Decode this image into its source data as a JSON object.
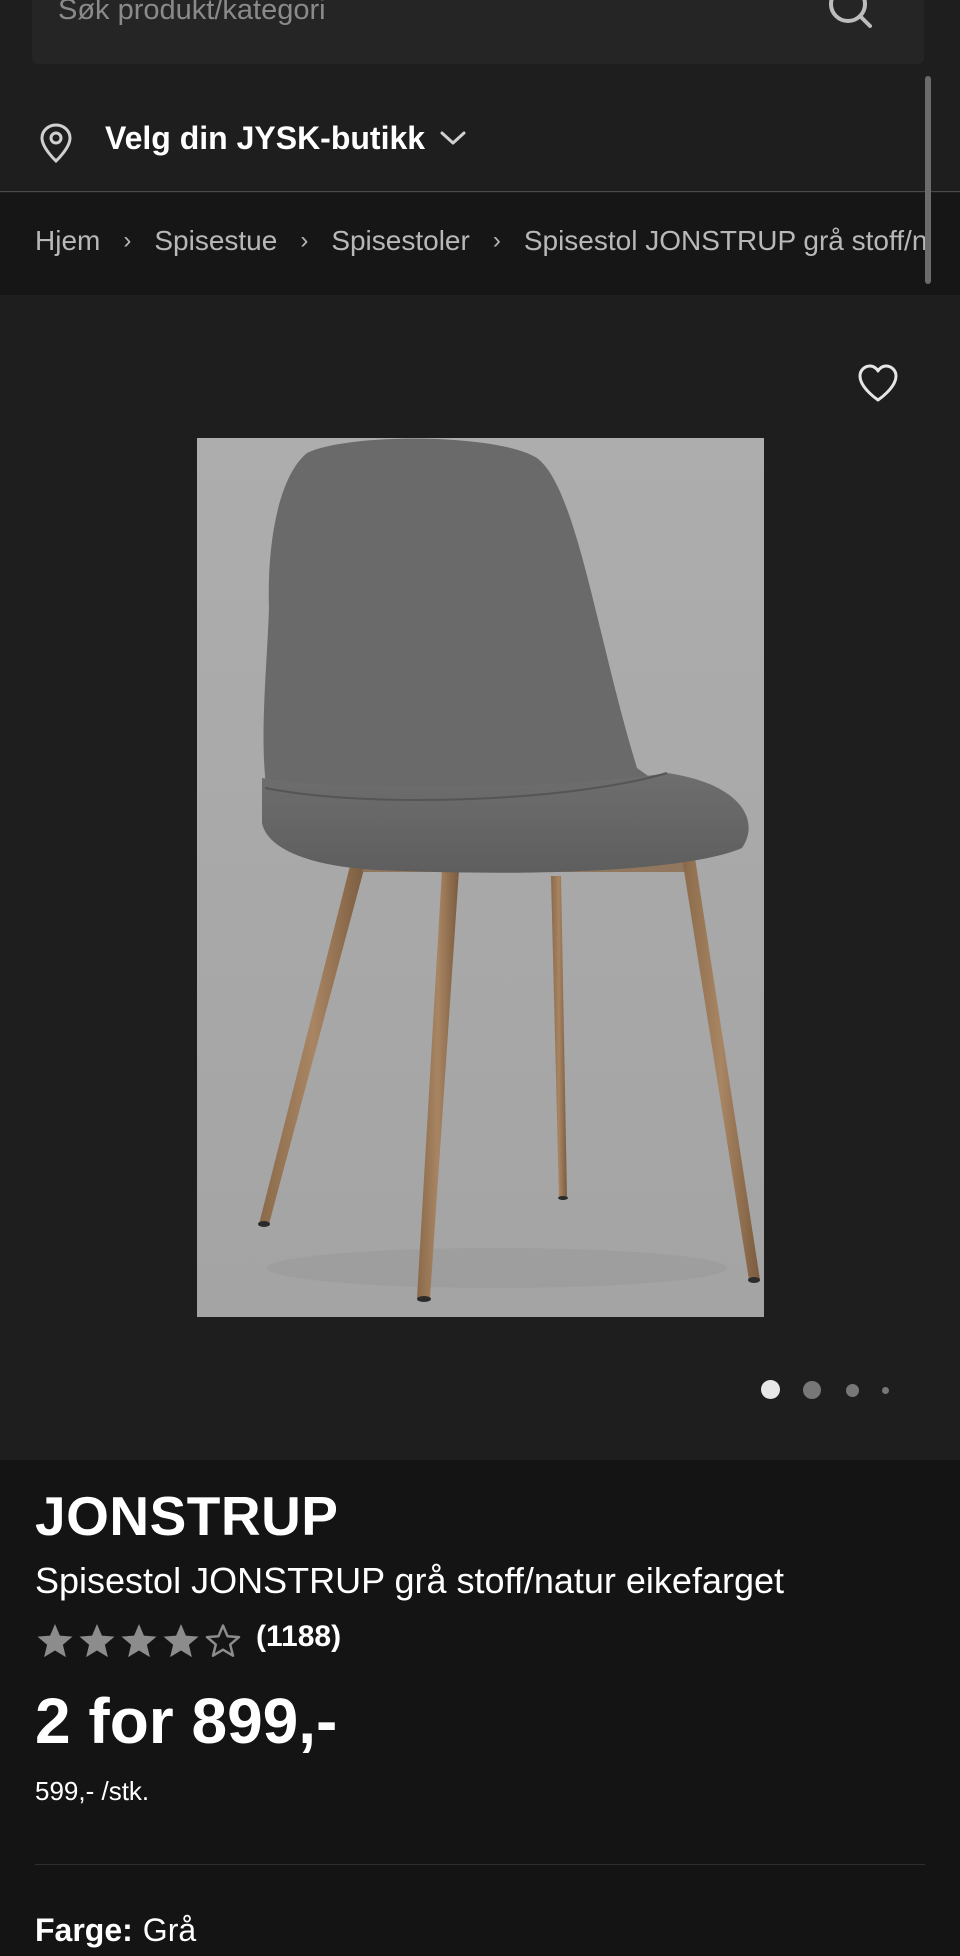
{
  "search": {
    "placeholder": "Søk produkt/kategori"
  },
  "store": {
    "label": "Velg din JYSK-butikk"
  },
  "breadcrumb": [
    "Hjem",
    "Spisestue",
    "Spisestoler",
    "Spisestol JONSTRUP grå stoff/n"
  ],
  "gallery": {
    "image_count": 4,
    "active_index": 0
  },
  "product": {
    "brand": "JONSTRUP",
    "title": "Spisestol JONSTRUP grå stoff/natur eikefarget",
    "rating": 4,
    "rating_max": 5,
    "review_count": "(1188)",
    "price": "2 for 899,-",
    "unit_price": "599,- /stk.",
    "color_label": "Farge:",
    "color_value": "Grå"
  },
  "colors": {
    "background": "#1e1e1e",
    "info_background": "#141414",
    "star_color": "#8c8c8c",
    "text": "#ffffff"
  }
}
